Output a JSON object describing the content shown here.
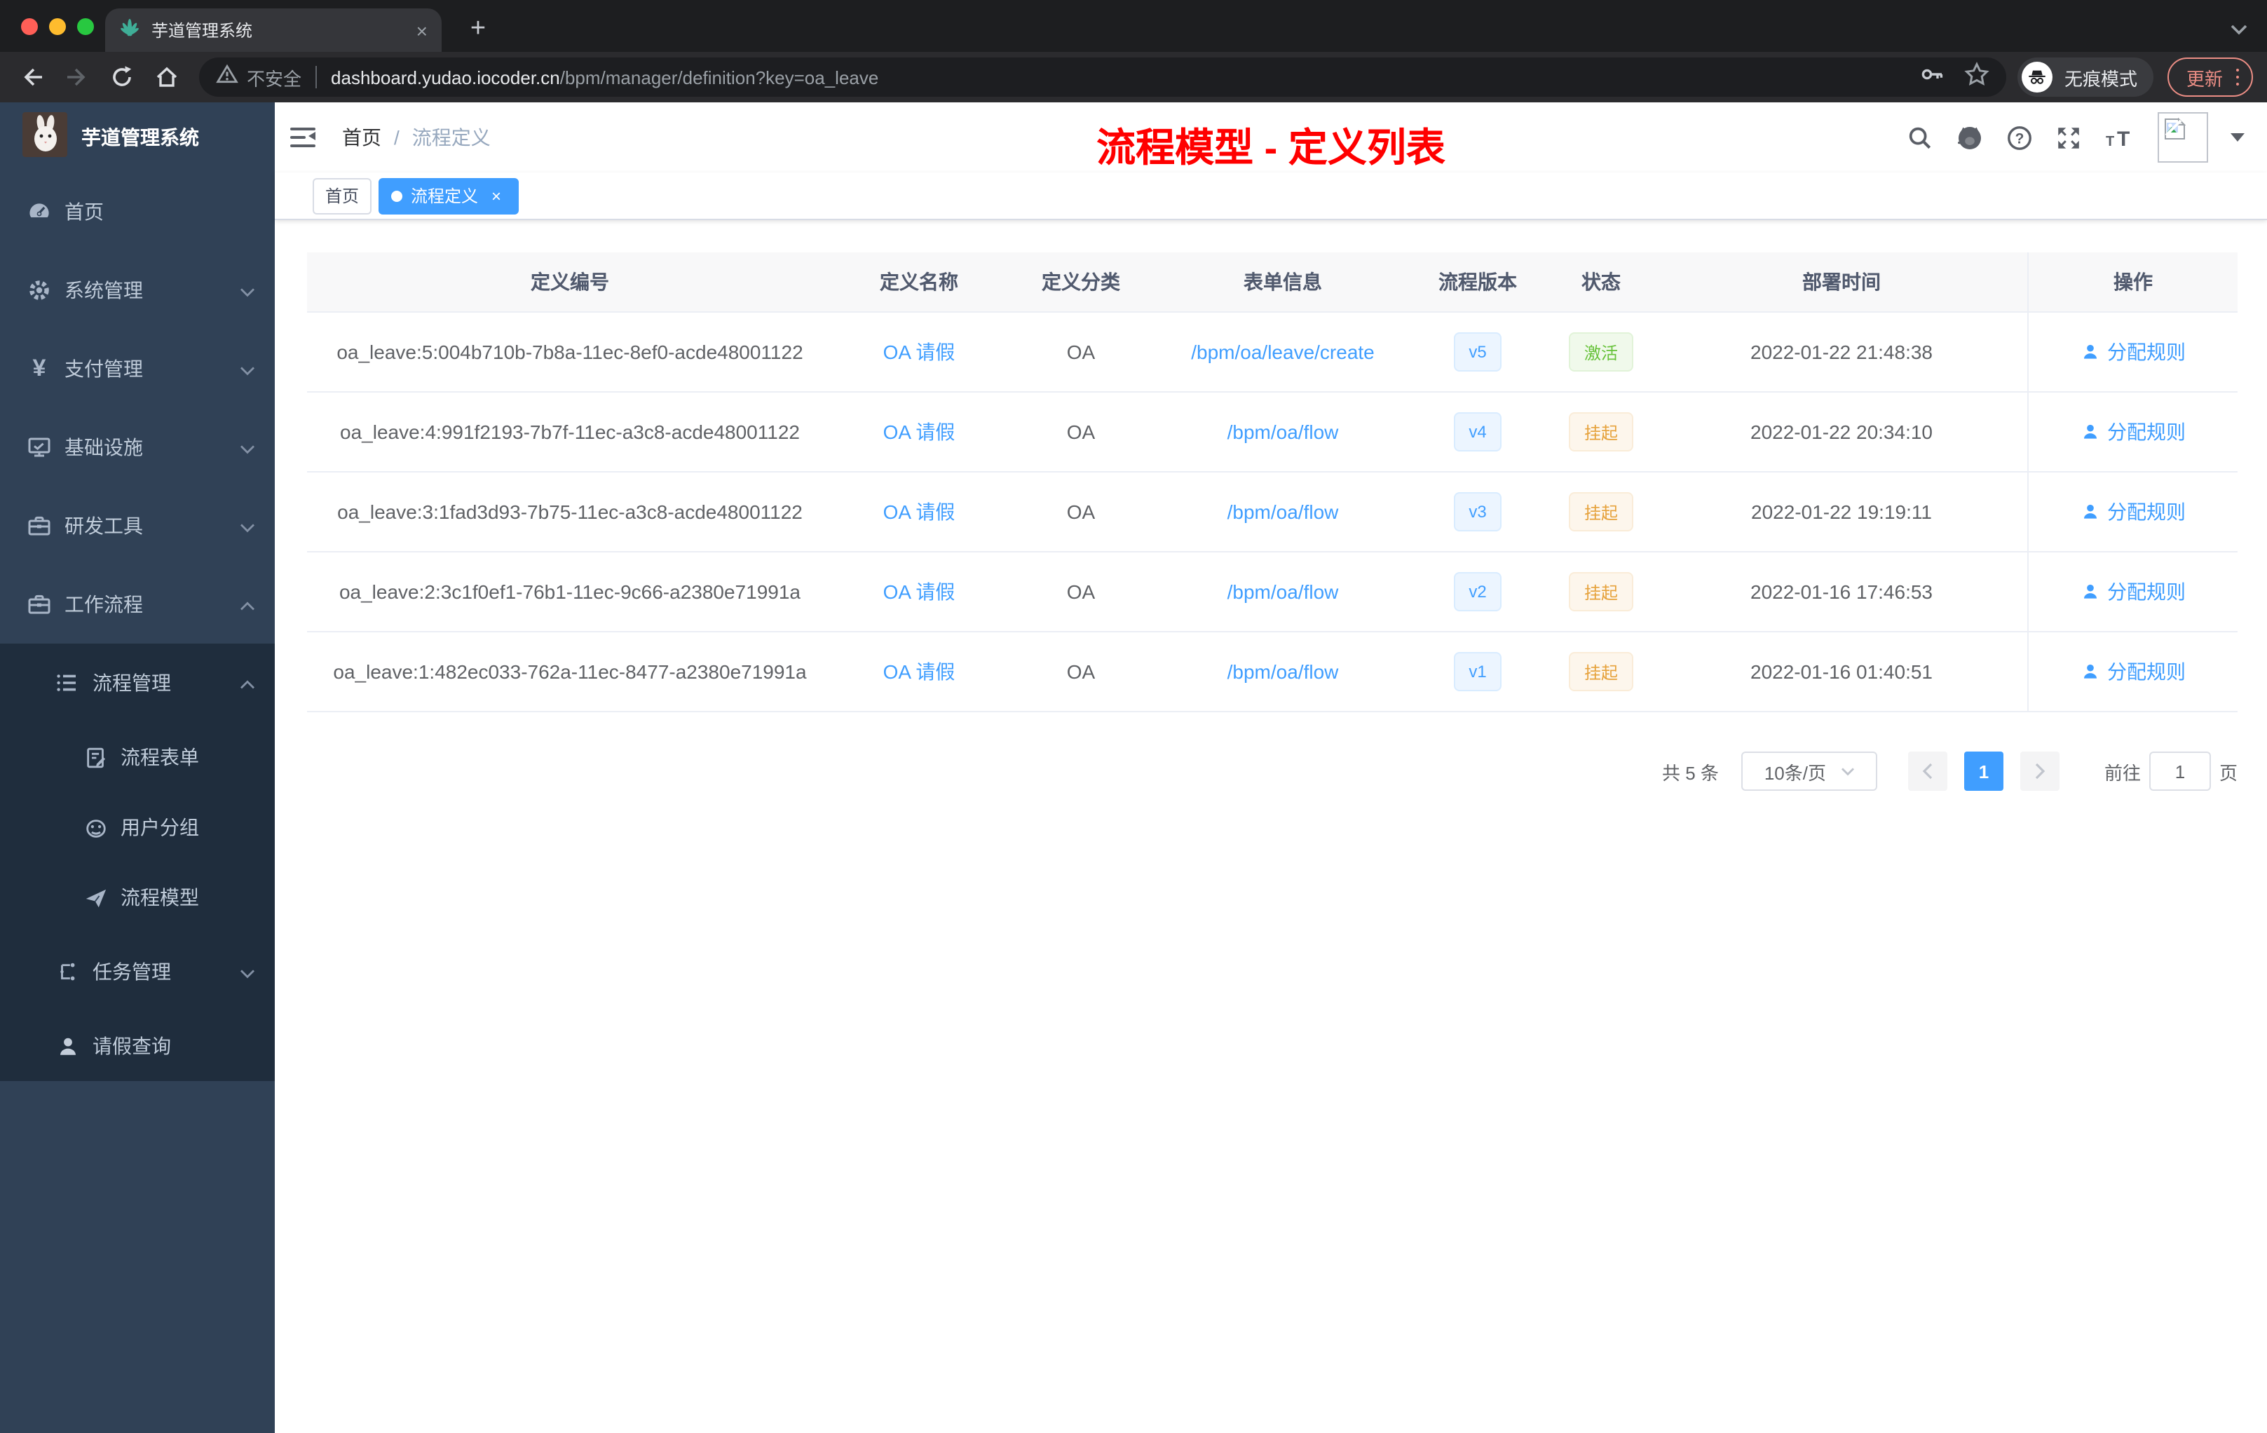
{
  "browser": {
    "tab": {
      "title": "芋道管理系统",
      "close_glyph": "×",
      "new_tab_glyph": "+"
    },
    "toolbar": {
      "security_label": "不安全",
      "url_domain": "dashboard.yudao.iocoder.cn",
      "url_path": "/bpm/manager/definition?key=oa_leave",
      "incognito_label": "无痕模式",
      "update_label": "更新"
    }
  },
  "icons": {
    "favicon": "plant-icon",
    "navbar": [
      "search-icon",
      "github-icon",
      "help-icon",
      "fullscreen-icon",
      "font-size-icon",
      "broken-image-avatar",
      "caret-down-icon"
    ],
    "toolbar": [
      "back-icon",
      "forward-icon",
      "reload-icon",
      "home-icon",
      "warning-icon",
      "key-icon",
      "star-icon",
      "incognito-icon",
      "kebab-menu-icon"
    ]
  },
  "sidebar": {
    "logo_title": "芋道管理系统",
    "items": [
      {
        "label": "首页"
      },
      {
        "label": "系统管理"
      },
      {
        "label": "支付管理"
      },
      {
        "label": "基础设施"
      },
      {
        "label": "研发工具"
      },
      {
        "label": "工作流程"
      }
    ],
    "submenu": [
      {
        "label": "流程管理"
      },
      {
        "label": "流程表单"
      },
      {
        "label": "用户分组"
      },
      {
        "label": "流程模型"
      },
      {
        "label": "任务管理"
      },
      {
        "label": "请假查询"
      }
    ]
  },
  "navbar": {
    "breadcrumb_home": "首页",
    "breadcrumb_sep": "/",
    "breadcrumb_current": "流程定义",
    "annotation": "流程模型 - 定义列表"
  },
  "tags": {
    "home": "首页",
    "active": "流程定义",
    "close_glyph": "×"
  },
  "table": {
    "columns": [
      "定义编号",
      "定义名称",
      "定义分类",
      "表单信息",
      "流程版本",
      "状态",
      "部署时间",
      "操作"
    ],
    "rows": [
      {
        "id": "oa_leave:5:004b710b-7b8a-11ec-8ef0-acde48001122",
        "name": "OA 请假",
        "category": "OA",
        "form": "/bpm/oa/leave/create",
        "version": "v5",
        "status": "激活",
        "time": "2022-01-22 21:48:38",
        "action": "分配规则"
      },
      {
        "id": "oa_leave:4:991f2193-7b7f-11ec-a3c8-acde48001122",
        "name": "OA 请假",
        "category": "OA",
        "form": "/bpm/oa/flow",
        "version": "v4",
        "status": "挂起",
        "time": "2022-01-22 20:34:10",
        "action": "分配规则"
      },
      {
        "id": "oa_leave:3:1fad3d93-7b75-11ec-a3c8-acde48001122",
        "name": "OA 请假",
        "category": "OA",
        "form": "/bpm/oa/flow",
        "version": "v3",
        "status": "挂起",
        "time": "2022-01-22 19:19:11",
        "action": "分配规则"
      },
      {
        "id": "oa_leave:2:3c1f0ef1-76b1-11ec-9c66-a2380e71991a",
        "name": "OA 请假",
        "category": "OA",
        "form": "/bpm/oa/flow",
        "version": "v2",
        "status": "挂起",
        "time": "2022-01-16 17:46:53",
        "action": "分配规则"
      },
      {
        "id": "oa_leave:1:482ec033-762a-11ec-8477-a2380e71991a",
        "name": "OA 请假",
        "category": "OA",
        "form": "/bpm/oa/flow",
        "version": "v1",
        "status": "挂起",
        "time": "2022-01-16 01:40:51",
        "action": "分配规则"
      }
    ]
  },
  "pagination": {
    "total": "共 5 条",
    "page_size": "10条/页",
    "current_page": "1",
    "goto_label": "前往",
    "goto_value": "1",
    "page_unit": "页"
  },
  "colors": {
    "accent_blue": "#409eff",
    "success_green": "#67c23a",
    "warning_yellow": "#e6a23c",
    "annotation_red": "#ff0000",
    "sidebar_bg": "#304156",
    "submenu_bg": "#1f2d3d"
  }
}
